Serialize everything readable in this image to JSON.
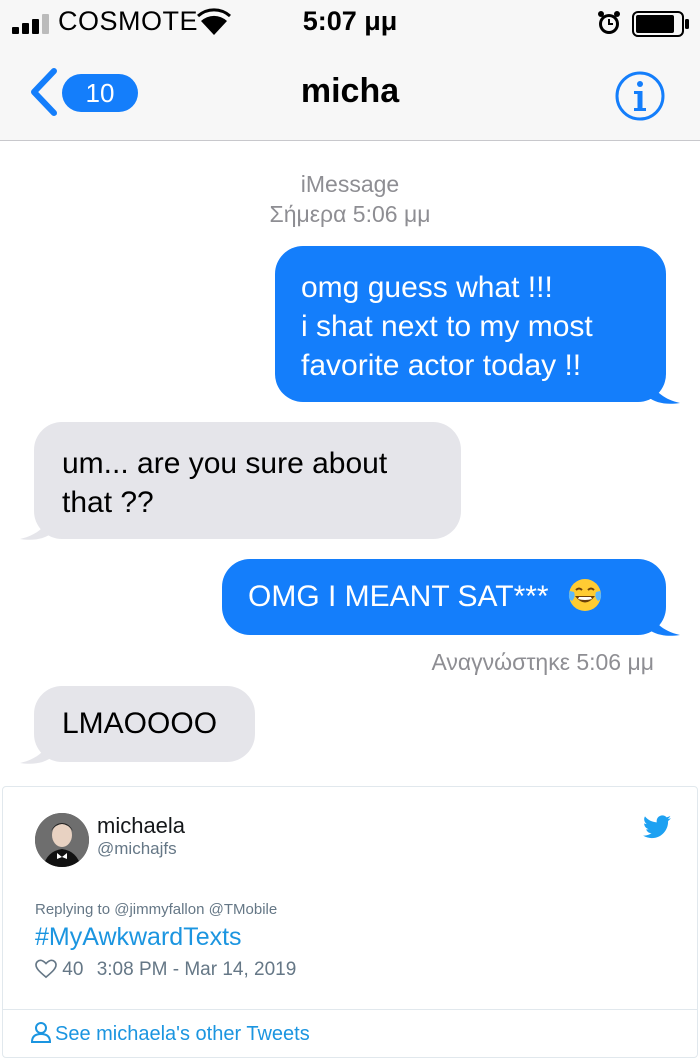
{
  "status_bar": {
    "carrier": "COSMOTE",
    "time": "5:07 μμ"
  },
  "nav": {
    "back_count": "10",
    "contact_name": "micha"
  },
  "thread": {
    "service": "iMessage",
    "date": "Σήμερα 5:06 μμ",
    "read_receipt": "Αναγνώστηκε 5:06 μμ",
    "messages": [
      {
        "direction": "outgoing",
        "lines": [
          "omg guess what !!!",
          "i shat next to my most",
          "favorite actor today !!"
        ]
      },
      {
        "direction": "incoming",
        "lines": [
          "um... are you sure about",
          "that ??"
        ]
      },
      {
        "direction": "outgoing",
        "lines": [
          "OMG I MEANT SAT***"
        ]
      },
      {
        "direction": "incoming",
        "lines": [
          "LMAOOOO"
        ]
      }
    ]
  },
  "tweet": {
    "name": "michaela",
    "handle": "@michajfs",
    "replying_to": "Replying to @jimmyfallon @TMobile",
    "hashtag": "#MyAwkwardTexts",
    "likes": "40",
    "timestamp": "3:08 PM - Mar 14, 2019",
    "more_link": "See michaela's other Tweets"
  },
  "colors": {
    "imessage_blue": "#147efb",
    "incoming_gray": "#e5e5ea",
    "twitter_blue": "#1b95e0"
  }
}
